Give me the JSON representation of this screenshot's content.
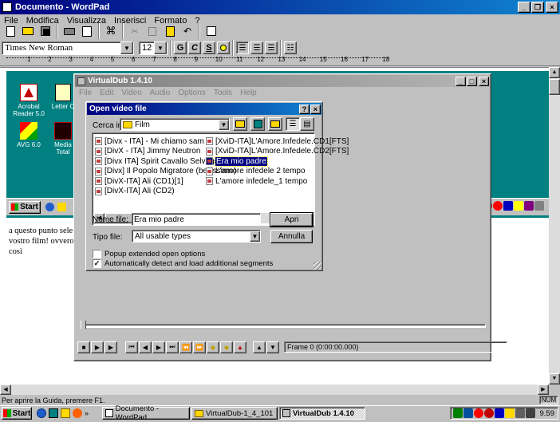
{
  "wordpad": {
    "title": "Documento - WordPad",
    "menu": [
      "File",
      "Modifica",
      "Visualizza",
      "Inserisci",
      "Formato",
      "?"
    ],
    "font_name": "Times New Roman",
    "font_size": "12",
    "format_buttons": {
      "bold": "G",
      "italic": "C",
      "underline": "S"
    },
    "ruler_marks": [
      "1",
      "2",
      "3",
      "4",
      "5",
      "6",
      "7",
      "8",
      "9",
      "10",
      "11",
      "12",
      "13",
      "14",
      "15",
      "16",
      "17",
      "18"
    ],
    "text_lines": [
      "a questo punto sele",
      "vostro film! ovvero",
      "così"
    ],
    "status": "Per aprire la Guida, premere F1.",
    "num": "NUM"
  },
  "desktop": {
    "icons": [
      {
        "label": "Acrobat Reader 5.0"
      },
      {
        "label": "Letter C"
      },
      {
        "label": "AVG 6.0"
      },
      {
        "label": "Media Total"
      }
    ],
    "inner_start": "Start"
  },
  "virtualdub": {
    "title": "VirtualDub 1.4.10",
    "menu": [
      "File",
      "Edit",
      "Video",
      "Audio",
      "Options",
      "Tools",
      "Help"
    ],
    "frame_label": "Frame 0 (0:00:00.000)"
  },
  "dialog": {
    "title": "Open video file",
    "look_in_label": "Cerca in:",
    "look_in_value": "Film",
    "files_left": [
      "[Divx - ITA] - Mi chiamo sam",
      "[DivX - ITA] Jimmy Neutron",
      "[Divx ITA] Spirit Cavallo Selvaggio",
      "[Divx] Il Popolo Migratore (bellissimo)",
      "[DivX-ITA] Ali (CD1)[1]",
      "[DivX-ITA] Ali (CD2)"
    ],
    "files_right": [
      "[XviD-ITA]L'Amore.Infedele.CD1[FTS]",
      "[XviD-ITA]L'Amore.Infedele.CD2[FTS]",
      "Era mio padre",
      "L'amore infedele 2 tempo",
      "L'amore infedele_1 tempo"
    ],
    "selected_file": "Era mio padre",
    "filename_label": "Nome file:",
    "filename_value": "Era mio padre",
    "filetype_label": "Tipo file:",
    "filetype_value": "All usable types",
    "open_button": "Apri",
    "cancel_button": "Annulla",
    "popup_label": "Popup extended open options",
    "popup_checked": false,
    "autodetect_label": "Automatically detect and load additional segments",
    "autodetect_checked": true
  },
  "taskbar": {
    "start": "Start",
    "tasks": [
      {
        "label": "Documento - WordPad",
        "active": false
      },
      {
        "label": "VirtualDub-1_4_101",
        "active": false
      },
      {
        "label": "VirtualDub 1.4.10",
        "active": true
      }
    ],
    "clock": "9.59"
  },
  "colors": {
    "title_active": "#000080",
    "desktop_teal": "#008080",
    "face": "#c0c0c0",
    "selection": "#000080"
  }
}
